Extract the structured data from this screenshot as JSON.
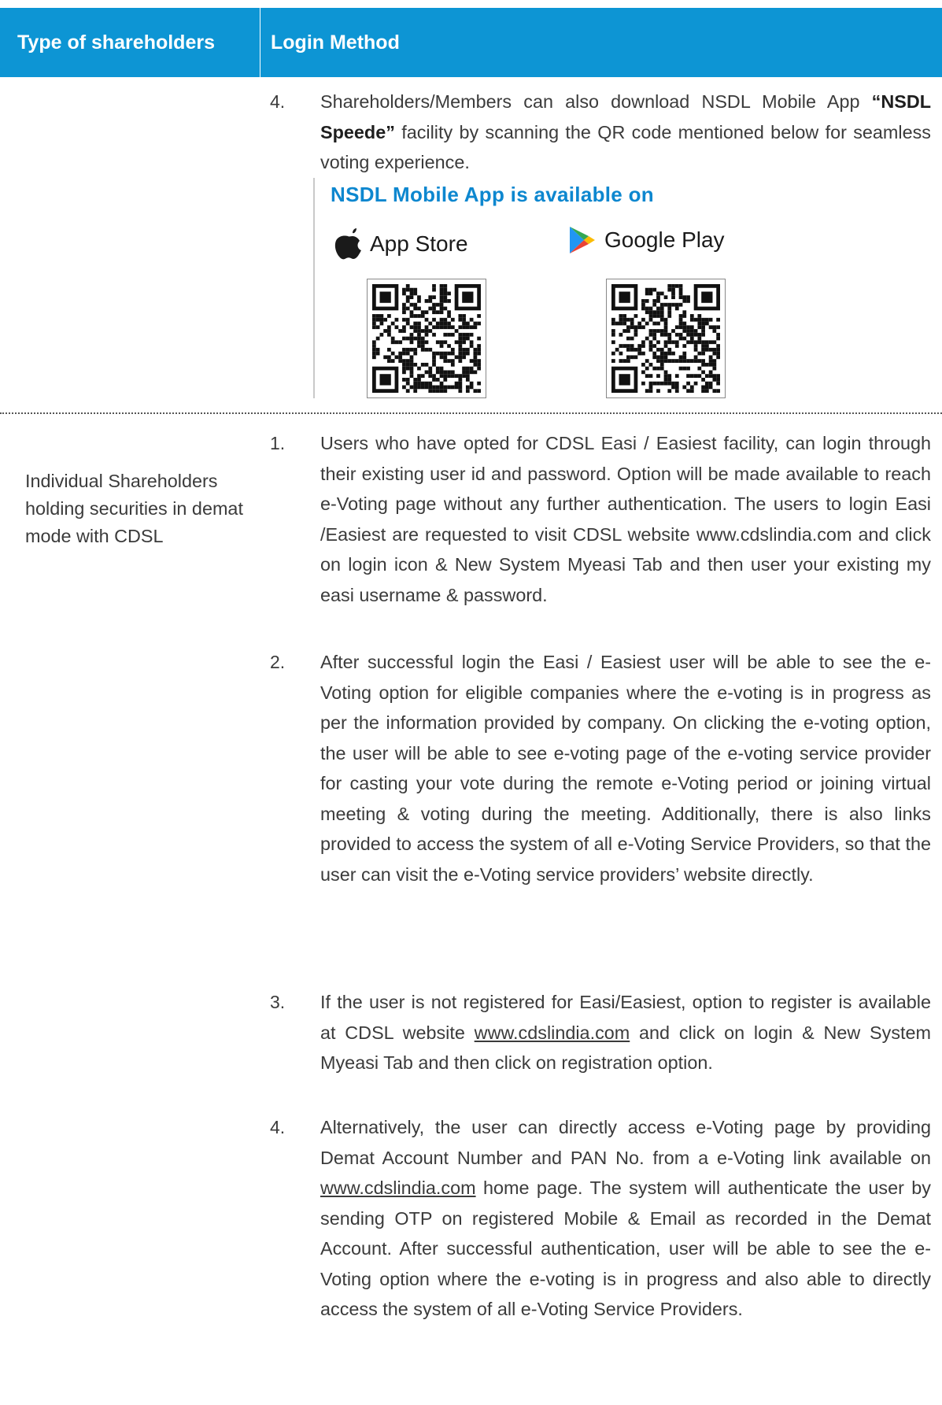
{
  "header": {
    "col1": "Type of shareholders",
    "col2": "Login Method"
  },
  "nsdl": {
    "item4": {
      "num": "4.",
      "text_a": "Shareholders/Members can also download NSDL Mobile App ",
      "bold": "“NSDL Speede”",
      "text_b": " facility by scanning the QR code mentioned below for seamless voting experience."
    },
    "app_title": "NSDL Mobile App is available on",
    "app_store": "App Store",
    "google_play": "Google Play"
  },
  "cdsl": {
    "label": "Individual Shareholders holding securities in demat mode with CDSL",
    "items": [
      {
        "num": "1.",
        "text": "Users who have opted for CDSL Easi / Easiest facility, can login through their existing user id and password. Option will be made available to reach e-Voting page without any further authentication. The users to login Easi /Easiest are requested to visit CDSL website www.cdslindia.com and click on login icon & New System Myeasi Tab and then user your existing my easi username & password."
      },
      {
        "num": "2.",
        "text": "After successful login the Easi / Easiest user will be able to see the e-Voting option for eligible companies where the e-voting is in progress as per the information provided by company. On clicking the e-voting option, the user will be able to see e-voting page of the e-voting service provider for casting your vote during the remote e-Voting period or joining virtual meeting & voting during the meeting. Additionally, there is also links provided to access the system of all e-Voting Service Providers, so that the user can visit the e-Voting service providers’ website directly."
      },
      {
        "num": "3.",
        "text_a": "If the user is not registered for Easi/Easiest, option to register is available at CDSL website ",
        "link": "www.cdslindia.com",
        "text_b": " and click on login & New System Myeasi Tab and then click on registration option."
      },
      {
        "num": "4.",
        "text_a": "Alternatively, the user can directly access e-Voting page by providing Demat Account Number and PAN No. from a e-Voting link available on ",
        "link": "www.cdslindia.com",
        "text_b": " home page. The system will authenticate the user by sending OTP on registered Mobile & Email as recorded in the Demat Account. After successful authentication, user will be able to see the e-Voting option where the e-voting is in progress and also able to directly access the system of all e-Voting Service Providers."
      }
    ]
  },
  "colors": {
    "header_bg": "#0d95d4",
    "app_title": "#0d87cf"
  }
}
